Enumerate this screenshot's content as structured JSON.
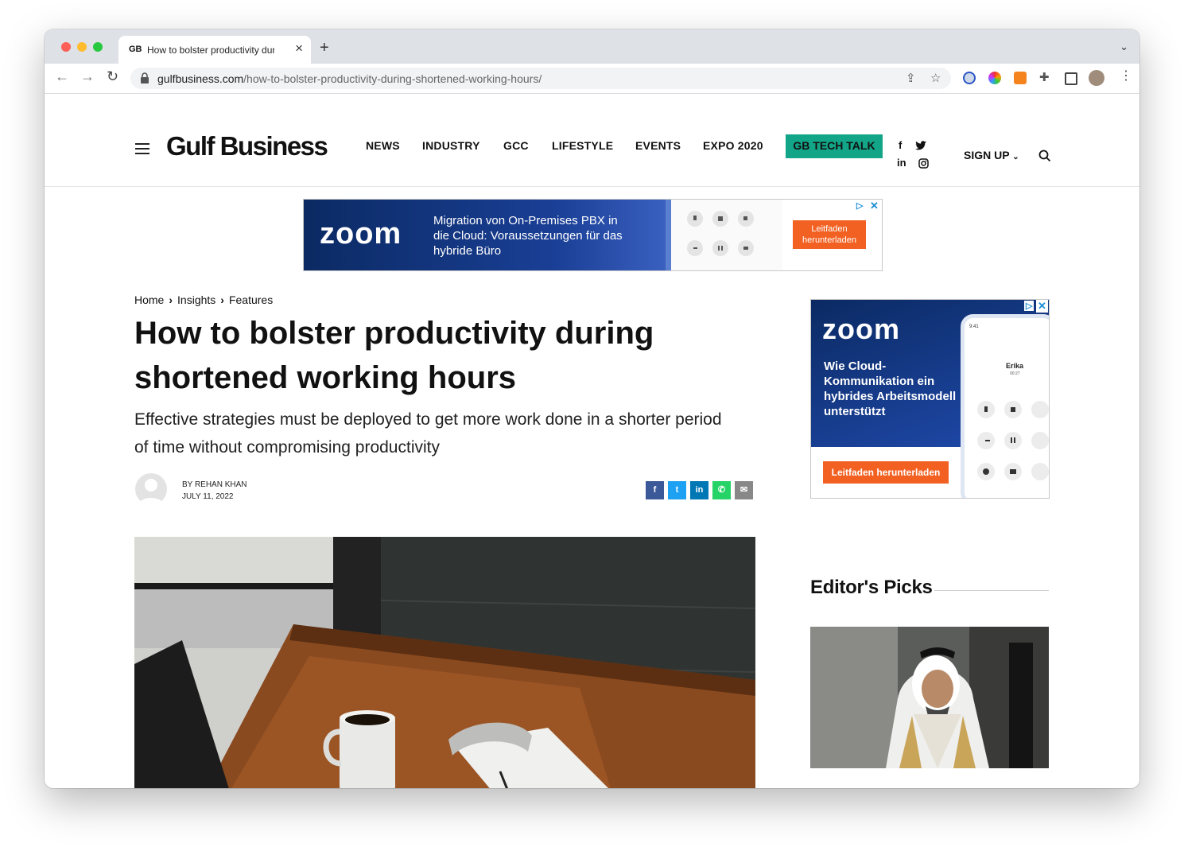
{
  "browser": {
    "tab_favicon": "GB",
    "tab_title": "How to bolster productivity during shortened working hours",
    "tab_close": "×",
    "new_tab": "+",
    "url_domain": "gulfbusiness.com",
    "url_path": "/how-to-bolster-productivity-during-shortened-working-hours/"
  },
  "site": {
    "logo": "Gulf Business",
    "nav": [
      "NEWS",
      "INDUSTRY",
      "GCC",
      "LIFESTYLE",
      "EVENTS",
      "EXPO 2020"
    ],
    "tech_talk": "GB TECH TALK",
    "signup": "SIGN UP",
    "accent": "#13a587"
  },
  "ad_top": {
    "brand": "zoom",
    "text": "Migration von On-Premises PBX in die Cloud: Voraussetzungen für das hybride Büro",
    "cta": "Leitfaden herunterladen"
  },
  "article": {
    "breadcrumb": [
      "Home",
      "Insights",
      "Features"
    ],
    "title": "How to bolster productivity during shortened working hours",
    "subtitle": "Effective strategies must be deployed to get more work done in a shorter period of time without compromising productivity",
    "author": "BY REHAN KHAN",
    "date": "JULY 11, 2022"
  },
  "ad_side": {
    "brand": "zoom",
    "text": "Wie Cloud-Kommunikation ein hybrides Arbeitsmodell unterstützt",
    "cta": "Leitfaden herunterladen",
    "phone_time": "9:41",
    "caller": "Erika",
    "call_time": "00:27"
  },
  "sidebar": {
    "picks_title": "Editor's Picks"
  }
}
